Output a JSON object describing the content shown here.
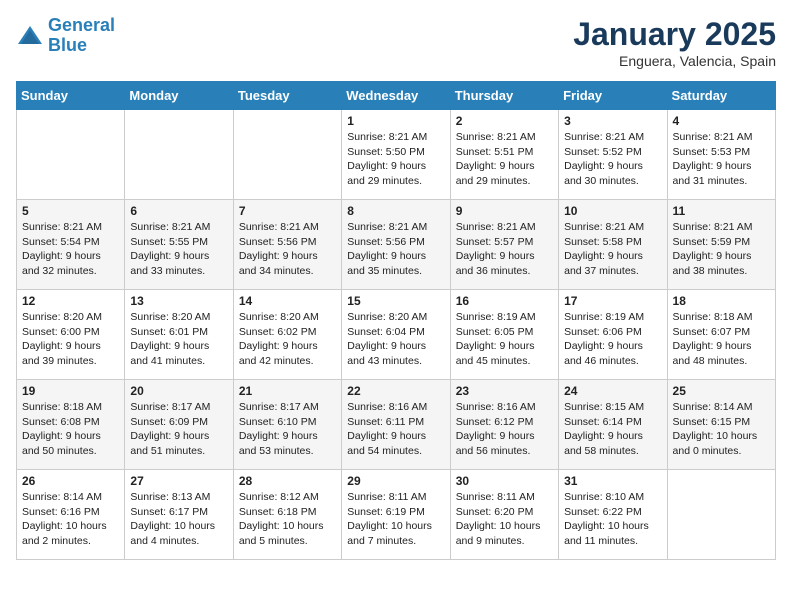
{
  "logo": {
    "line1": "General",
    "line2": "Blue"
  },
  "title": "January 2025",
  "location": "Enguera, Valencia, Spain",
  "weekdays": [
    "Sunday",
    "Monday",
    "Tuesday",
    "Wednesday",
    "Thursday",
    "Friday",
    "Saturday"
  ],
  "weeks": [
    [
      {
        "day": "",
        "sunrise": "",
        "sunset": "",
        "daylight": ""
      },
      {
        "day": "",
        "sunrise": "",
        "sunset": "",
        "daylight": ""
      },
      {
        "day": "",
        "sunrise": "",
        "sunset": "",
        "daylight": ""
      },
      {
        "day": "1",
        "sunrise": "Sunrise: 8:21 AM",
        "sunset": "Sunset: 5:50 PM",
        "daylight": "Daylight: 9 hours and 29 minutes."
      },
      {
        "day": "2",
        "sunrise": "Sunrise: 8:21 AM",
        "sunset": "Sunset: 5:51 PM",
        "daylight": "Daylight: 9 hours and 29 minutes."
      },
      {
        "day": "3",
        "sunrise": "Sunrise: 8:21 AM",
        "sunset": "Sunset: 5:52 PM",
        "daylight": "Daylight: 9 hours and 30 minutes."
      },
      {
        "day": "4",
        "sunrise": "Sunrise: 8:21 AM",
        "sunset": "Sunset: 5:53 PM",
        "daylight": "Daylight: 9 hours and 31 minutes."
      }
    ],
    [
      {
        "day": "5",
        "sunrise": "Sunrise: 8:21 AM",
        "sunset": "Sunset: 5:54 PM",
        "daylight": "Daylight: 9 hours and 32 minutes."
      },
      {
        "day": "6",
        "sunrise": "Sunrise: 8:21 AM",
        "sunset": "Sunset: 5:55 PM",
        "daylight": "Daylight: 9 hours and 33 minutes."
      },
      {
        "day": "7",
        "sunrise": "Sunrise: 8:21 AM",
        "sunset": "Sunset: 5:56 PM",
        "daylight": "Daylight: 9 hours and 34 minutes."
      },
      {
        "day": "8",
        "sunrise": "Sunrise: 8:21 AM",
        "sunset": "Sunset: 5:56 PM",
        "daylight": "Daylight: 9 hours and 35 minutes."
      },
      {
        "day": "9",
        "sunrise": "Sunrise: 8:21 AM",
        "sunset": "Sunset: 5:57 PM",
        "daylight": "Daylight: 9 hours and 36 minutes."
      },
      {
        "day": "10",
        "sunrise": "Sunrise: 8:21 AM",
        "sunset": "Sunset: 5:58 PM",
        "daylight": "Daylight: 9 hours and 37 minutes."
      },
      {
        "day": "11",
        "sunrise": "Sunrise: 8:21 AM",
        "sunset": "Sunset: 5:59 PM",
        "daylight": "Daylight: 9 hours and 38 minutes."
      }
    ],
    [
      {
        "day": "12",
        "sunrise": "Sunrise: 8:20 AM",
        "sunset": "Sunset: 6:00 PM",
        "daylight": "Daylight: 9 hours and 39 minutes."
      },
      {
        "day": "13",
        "sunrise": "Sunrise: 8:20 AM",
        "sunset": "Sunset: 6:01 PM",
        "daylight": "Daylight: 9 hours and 41 minutes."
      },
      {
        "day": "14",
        "sunrise": "Sunrise: 8:20 AM",
        "sunset": "Sunset: 6:02 PM",
        "daylight": "Daylight: 9 hours and 42 minutes."
      },
      {
        "day": "15",
        "sunrise": "Sunrise: 8:20 AM",
        "sunset": "Sunset: 6:04 PM",
        "daylight": "Daylight: 9 hours and 43 minutes."
      },
      {
        "day": "16",
        "sunrise": "Sunrise: 8:19 AM",
        "sunset": "Sunset: 6:05 PM",
        "daylight": "Daylight: 9 hours and 45 minutes."
      },
      {
        "day": "17",
        "sunrise": "Sunrise: 8:19 AM",
        "sunset": "Sunset: 6:06 PM",
        "daylight": "Daylight: 9 hours and 46 minutes."
      },
      {
        "day": "18",
        "sunrise": "Sunrise: 8:18 AM",
        "sunset": "Sunset: 6:07 PM",
        "daylight": "Daylight: 9 hours and 48 minutes."
      }
    ],
    [
      {
        "day": "19",
        "sunrise": "Sunrise: 8:18 AM",
        "sunset": "Sunset: 6:08 PM",
        "daylight": "Daylight: 9 hours and 50 minutes."
      },
      {
        "day": "20",
        "sunrise": "Sunrise: 8:17 AM",
        "sunset": "Sunset: 6:09 PM",
        "daylight": "Daylight: 9 hours and 51 minutes."
      },
      {
        "day": "21",
        "sunrise": "Sunrise: 8:17 AM",
        "sunset": "Sunset: 6:10 PM",
        "daylight": "Daylight: 9 hours and 53 minutes."
      },
      {
        "day": "22",
        "sunrise": "Sunrise: 8:16 AM",
        "sunset": "Sunset: 6:11 PM",
        "daylight": "Daylight: 9 hours and 54 minutes."
      },
      {
        "day": "23",
        "sunrise": "Sunrise: 8:16 AM",
        "sunset": "Sunset: 6:12 PM",
        "daylight": "Daylight: 9 hours and 56 minutes."
      },
      {
        "day": "24",
        "sunrise": "Sunrise: 8:15 AM",
        "sunset": "Sunset: 6:14 PM",
        "daylight": "Daylight: 9 hours and 58 minutes."
      },
      {
        "day": "25",
        "sunrise": "Sunrise: 8:14 AM",
        "sunset": "Sunset: 6:15 PM",
        "daylight": "Daylight: 10 hours and 0 minutes."
      }
    ],
    [
      {
        "day": "26",
        "sunrise": "Sunrise: 8:14 AM",
        "sunset": "Sunset: 6:16 PM",
        "daylight": "Daylight: 10 hours and 2 minutes."
      },
      {
        "day": "27",
        "sunrise": "Sunrise: 8:13 AM",
        "sunset": "Sunset: 6:17 PM",
        "daylight": "Daylight: 10 hours and 4 minutes."
      },
      {
        "day": "28",
        "sunrise": "Sunrise: 8:12 AM",
        "sunset": "Sunset: 6:18 PM",
        "daylight": "Daylight: 10 hours and 5 minutes."
      },
      {
        "day": "29",
        "sunrise": "Sunrise: 8:11 AM",
        "sunset": "Sunset: 6:19 PM",
        "daylight": "Daylight: 10 hours and 7 minutes."
      },
      {
        "day": "30",
        "sunrise": "Sunrise: 8:11 AM",
        "sunset": "Sunset: 6:20 PM",
        "daylight": "Daylight: 10 hours and 9 minutes."
      },
      {
        "day": "31",
        "sunrise": "Sunrise: 8:10 AM",
        "sunset": "Sunset: 6:22 PM",
        "daylight": "Daylight: 10 hours and 11 minutes."
      },
      {
        "day": "",
        "sunrise": "",
        "sunset": "",
        "daylight": ""
      }
    ]
  ]
}
